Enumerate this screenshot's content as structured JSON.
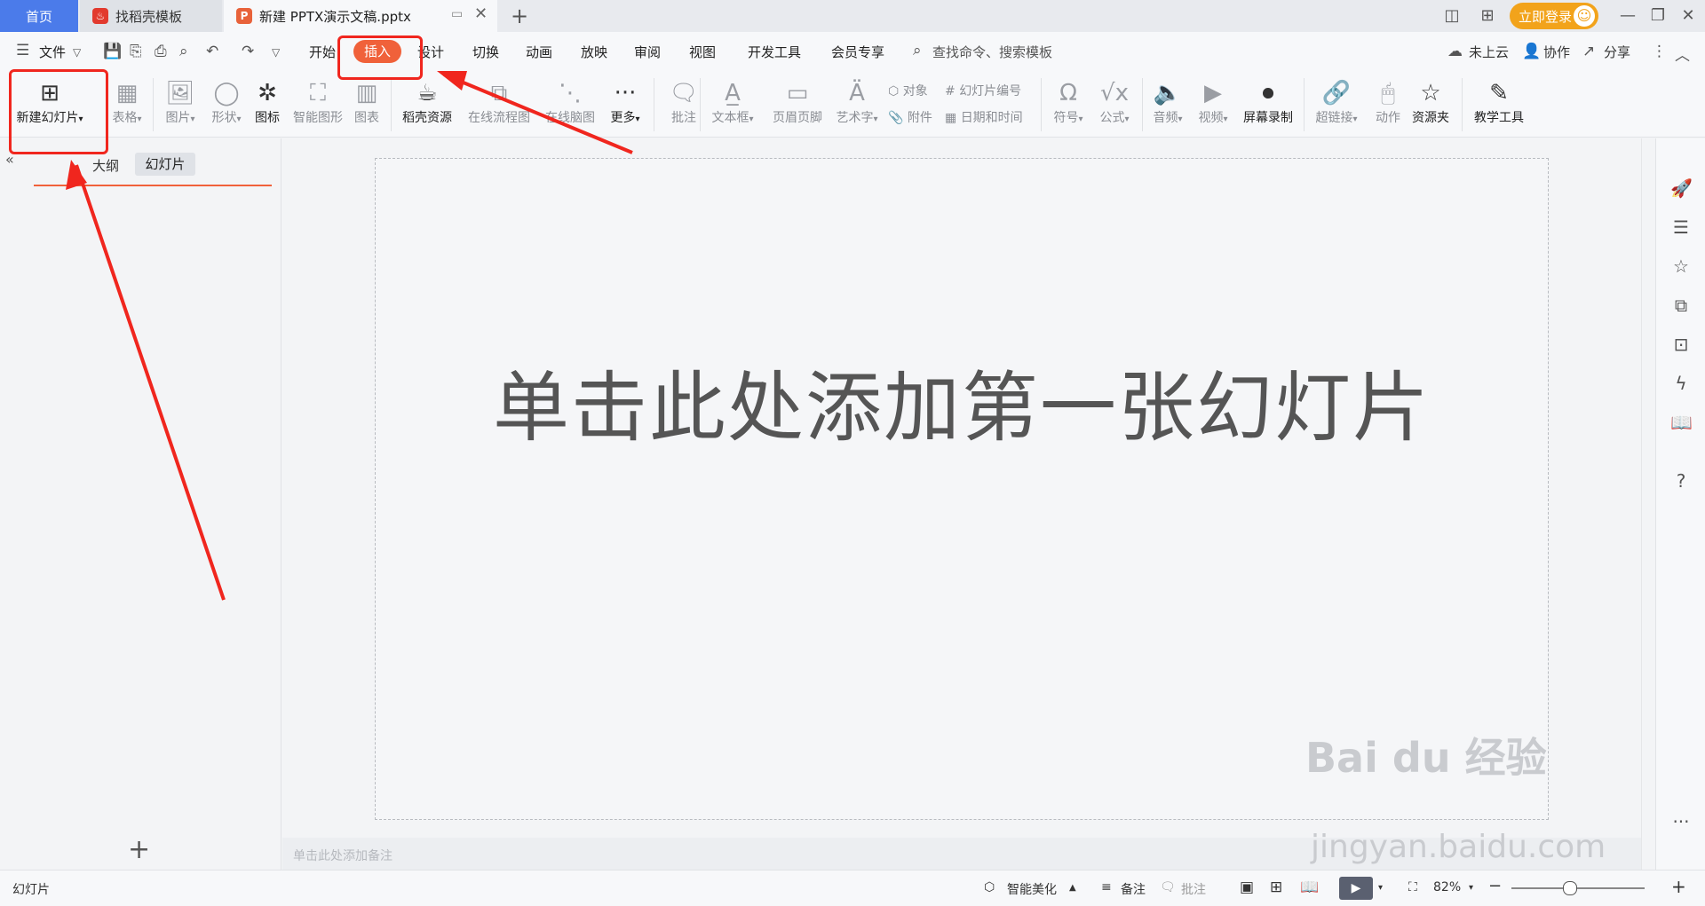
{
  "titlebar": {
    "tabs": [
      {
        "label": "首页"
      },
      {
        "label": "找稻壳模板"
      },
      {
        "label": "新建 PPTX演示文稿.pptx"
      }
    ],
    "login_label": "立即登录"
  },
  "menu": {
    "file_label": "文件",
    "tabs": [
      "开始",
      "插入",
      "设计",
      "切换",
      "动画",
      "放映",
      "审阅",
      "视图",
      "开发工具",
      "会员专享"
    ],
    "search_placeholder": "查找命令、搜索模板",
    "cloud_label": "未上云",
    "collab_label": "协作",
    "share_label": "分享",
    "active_tab": "插入"
  },
  "ribbon": {
    "new_slide": "新建幻灯片",
    "table": "表格",
    "picture": "图片",
    "shape": "形状",
    "icon": "图标",
    "smart_shape": "智能图形",
    "chart": "图表",
    "docer_resource": "稻壳资源",
    "online_flowchart": "在线流程图",
    "online_mindmap": "在线脑图",
    "more": "更多",
    "comment": "批注",
    "textbox": "文本框",
    "header_footer": "页眉页脚",
    "wordart": "艺术字",
    "object": "对象",
    "attachment": "附件",
    "slide_number": "幻灯片编号",
    "date_time": "日期和时间",
    "symbol": "符号",
    "formula": "公式",
    "audio": "音频",
    "video": "视频",
    "screen_record": "屏幕录制",
    "hyperlink": "超链接",
    "action": "动作",
    "resource_folder": "资源夹",
    "teaching_tools": "教学工具"
  },
  "leftpane": {
    "outline_label": "大纲",
    "slides_label": "幻灯片"
  },
  "canvas": {
    "placeholder": "单击此处添加第一张幻灯片",
    "notes_placeholder": "单击此处添加备注"
  },
  "statusbar": {
    "slides_label": "幻灯片",
    "beautify_label": "智能美化",
    "notes_label": "备注",
    "comment_label": "批注",
    "zoom": "82%"
  },
  "watermark": {
    "brand": "Bai du 经验",
    "url": "jingyan.baidu.com"
  },
  "colors": {
    "accent": "#f0613a",
    "home_tab": "#4b7bea",
    "login": "#f2a31b",
    "annotation_red": "#f0261e"
  }
}
